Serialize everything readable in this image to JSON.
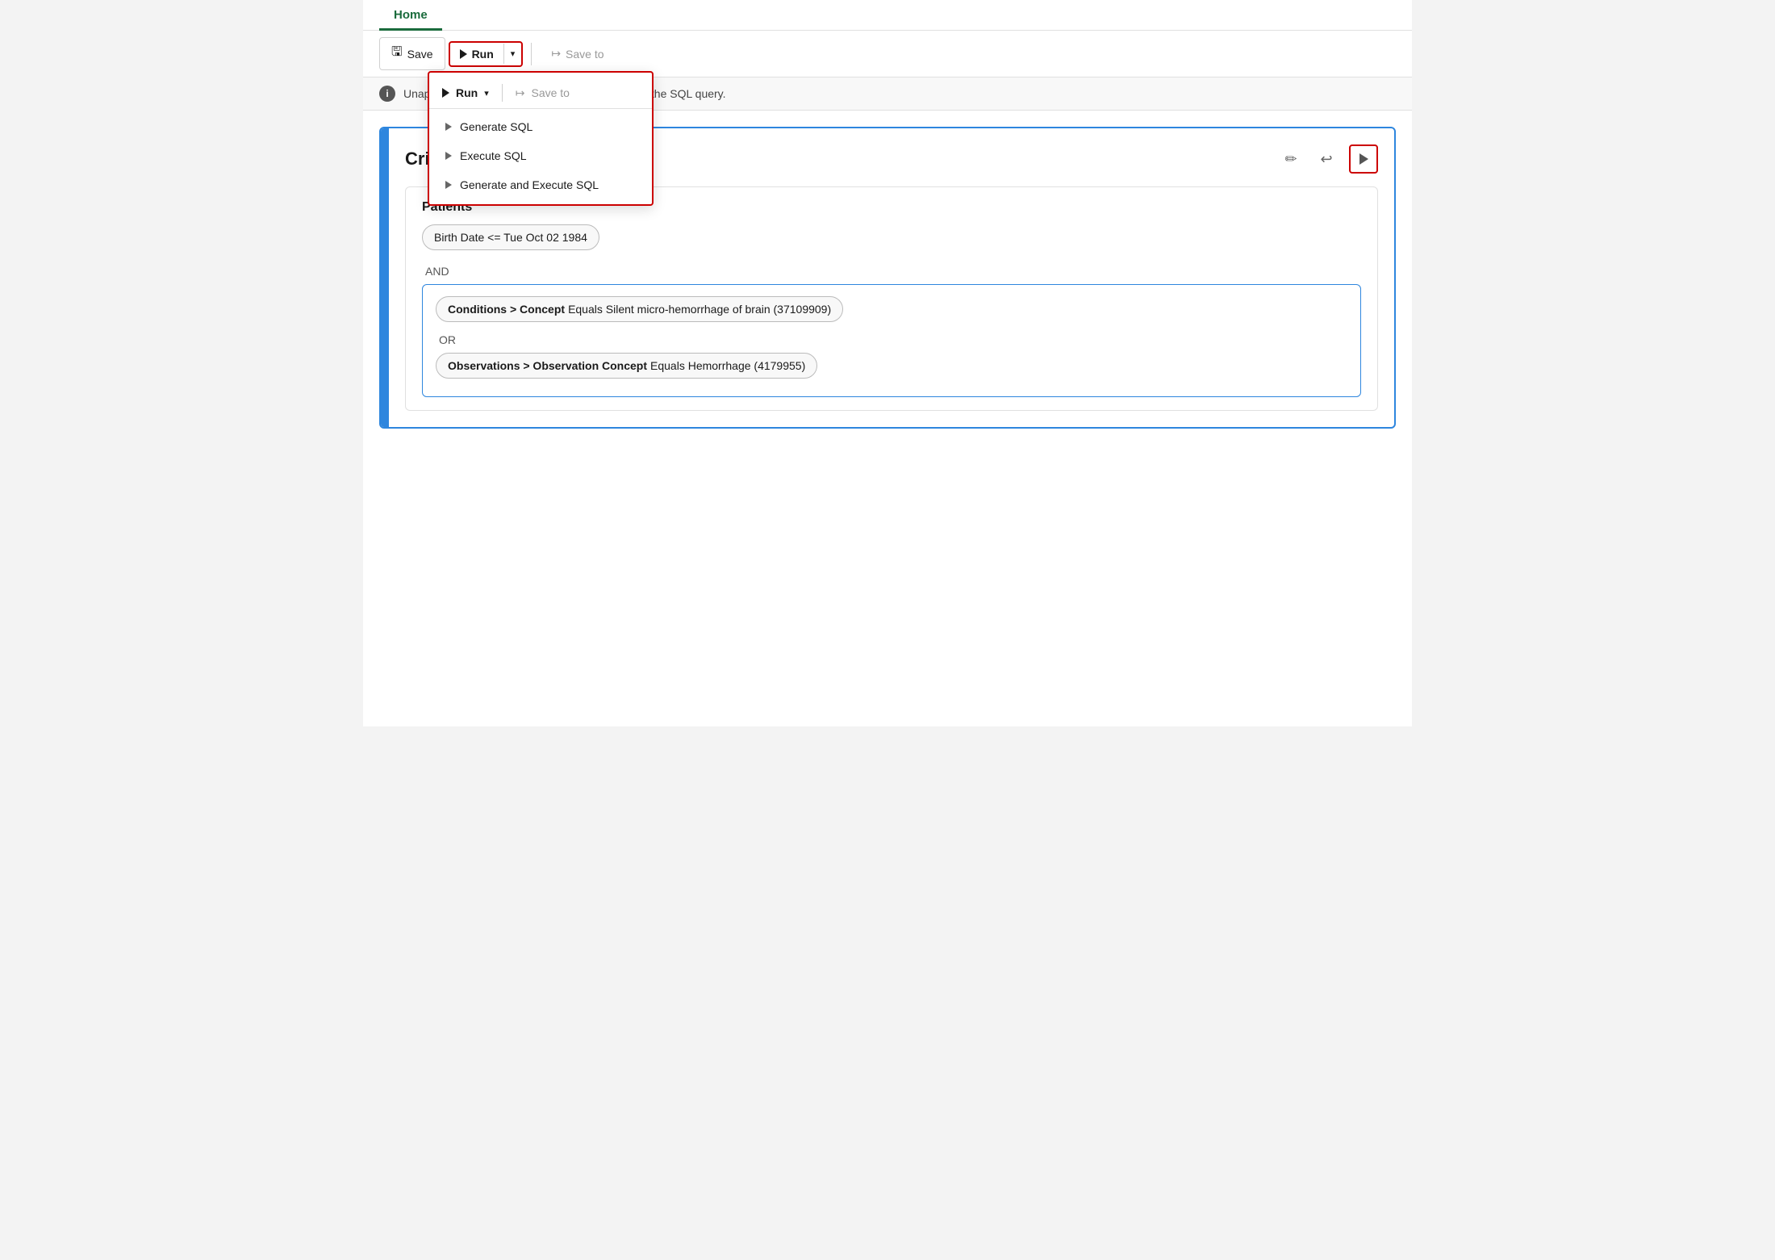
{
  "nav": {
    "tab_home": "Home"
  },
  "toolbar": {
    "save_label": "Save",
    "run_label": "Run",
    "save_to_label": "Save to"
  },
  "dropdown": {
    "items": [
      {
        "label": "Generate SQL"
      },
      {
        "label": "Execute SQL"
      },
      {
        "label": "Generate and Execute SQL"
      }
    ]
  },
  "info_banner": {
    "text": "Unapplied changes. Generate the SQL to update the SQL query."
  },
  "criteria": {
    "title": "Crite",
    "patients_title": "Patients",
    "birth_date_chip": "Birth Date  <=  Tue Oct 02 1984",
    "and_label": "AND",
    "or_label": "OR",
    "conditions_chip_bold": "Conditions > Concept",
    "conditions_chip_text": " Equals Silent micro-hemorrhage of brain (37109909)",
    "observations_chip_bold": "Observations > Observation Concept",
    "observations_chip_text": " Equals Hemorrhage (4179955)"
  }
}
